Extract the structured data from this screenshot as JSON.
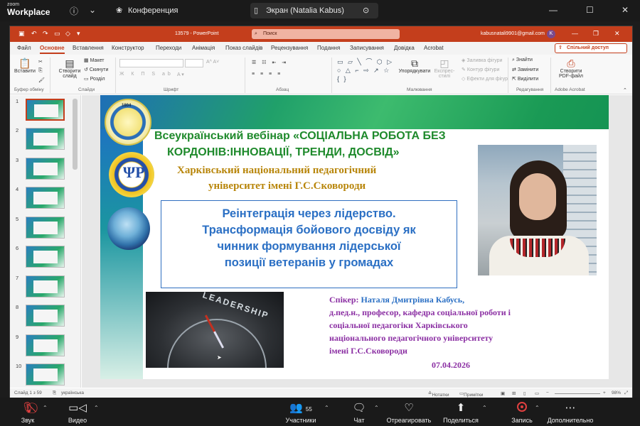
{
  "zoom": {
    "logo_small": "zoom",
    "logo_big": "Workplace",
    "tabs": [
      {
        "label": "Конференция",
        "icon": "paw-icon"
      },
      {
        "label": "Экран (Natalia Kabus)",
        "icon": "screen-share-icon"
      }
    ],
    "toolbar": {
      "mute_label": "Звук",
      "video_label": "Видео",
      "participants_label": "Участники",
      "participants_count": "55",
      "chat_label": "Чат",
      "react_label": "Отреагировать",
      "share_label": "Поделиться",
      "record_label": "Запись",
      "more_label": "Дополнительно"
    }
  },
  "ppt": {
    "doc_title": "13579 - PowerPoint",
    "search_placeholder": "Поиск",
    "account_email": "kabusnatali9901@gmail.com",
    "avatar_letter": "K",
    "menu_tabs": [
      "Файл",
      "Основне",
      "Вставлення",
      "Конструктор",
      "Переходи",
      "Анімація",
      "Показ слайдів",
      "Рецензування",
      "Подання",
      "Записування",
      "Довідка",
      "Acrobat"
    ],
    "share_button": "Спільний доступ",
    "ribbon": {
      "paste": "Вставити",
      "new_slide": "Створити слайд",
      "layout": "Макет",
      "reset": "Скинути",
      "section": "Розділ",
      "arrange": "Упорядкувати",
      "quick_styles": "Експрес-стилі",
      "shape_fill": "Заливка фігури",
      "shape_outline": "Контур фігури",
      "shape_effects": "Ефекти для фігур",
      "find": "Знайти",
      "replace": "Замінити",
      "select": "Виділити",
      "create_pdf": "Створити PDF-файл",
      "groups": [
        "Буфер обміну",
        "Слайди",
        "Шрифт",
        "Абзац",
        "Малювання",
        "Редагування",
        "Adobe Acrobat"
      ]
    },
    "thumbnails": [
      "1",
      "2",
      "3",
      "4",
      "5",
      "6",
      "7",
      "8",
      "9",
      "10"
    ],
    "status": {
      "slide_info": "Слайд 1 з 59",
      "language": "українська",
      "notes": "Нотатки",
      "comments": "Примітки",
      "zoom_pct": "98%"
    }
  },
  "slide": {
    "seal_year": "1804",
    "title_line1": "Всеукраїнський вебінар «СОЦІАЛЬНА РОБОТА БЕЗ",
    "title_line2": "КОРДОНІВ:ІННОВАЦІЇ, ТРЕНДИ, ДОСВІД»",
    "uni_line1": "Харківський національний педагогічний",
    "uni_line2": "університет імені Г.С.Сковороди",
    "topic_lines": [
      "Реінтеграція через лідерство.",
      "Трансформація бойового досвіду як",
      "чинник формування лідерської",
      "позиції ветеранів у громадах"
    ],
    "image_text": "LEADERSHIP",
    "speaker_label": "Спікер:",
    "speaker_name": "Наталя Дмитрівна Кабусь,",
    "speaker_line2": "д.пед.н., професор, кафедра соціальної роботи і",
    "speaker_line3": "соціальної педагогіки Харківського",
    "speaker_line4": "національного педагогічного університету",
    "speaker_line5": "імені Г.С.Сковороди",
    "date": "07.04.2026"
  }
}
